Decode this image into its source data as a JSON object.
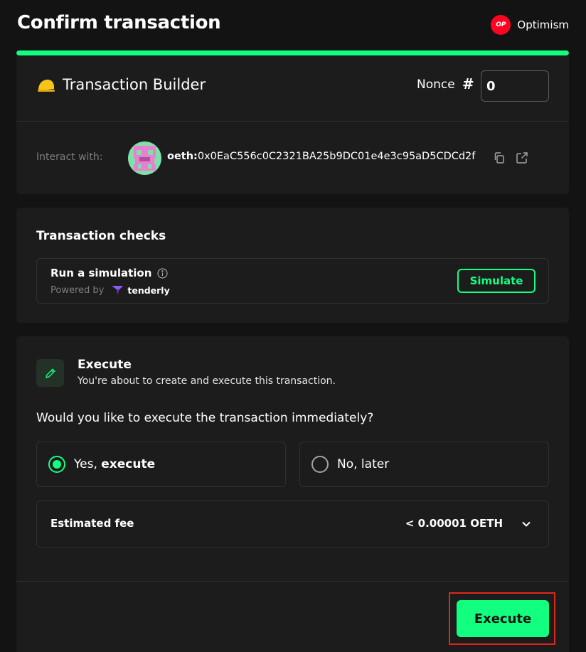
{
  "header": {
    "title": "Confirm transaction",
    "network_badge": "OP",
    "network_name": "Optimism"
  },
  "progress": {
    "percent": 100,
    "color": "#12ff80"
  },
  "transaction": {
    "app_name": "Transaction Builder",
    "app_icon": "hard-hat-icon",
    "nonce_label": "Nonce",
    "nonce_hash": "#",
    "nonce_value": "0",
    "interact_label": "Interact with:",
    "address_prefix": "oeth:",
    "address": "0x0EaC556c0C2321BA25b9DC01e4e3c95aD5CDCd2f"
  },
  "checks": {
    "title": "Transaction checks",
    "simulation_title": "Run a simulation",
    "powered_by": "Powered by",
    "provider": "tenderly",
    "simulate_label": "Simulate"
  },
  "execute": {
    "title": "Execute",
    "description": "You're about to create and execute this transaction.",
    "question": "Would you like to execute the transaction immediately?",
    "yes_prefix": "Yes,",
    "yes_strong": "execute",
    "no_label": "No, later",
    "selected": "yes",
    "fee_label": "Estimated fee",
    "fee_value": "< 0.00001 OETH",
    "button_label": "Execute"
  },
  "colors": {
    "accent": "#12ff80",
    "background": "#121312",
    "card": "#1c1c1c",
    "highlight": "#e0261b",
    "optimism": "#ff0420"
  }
}
